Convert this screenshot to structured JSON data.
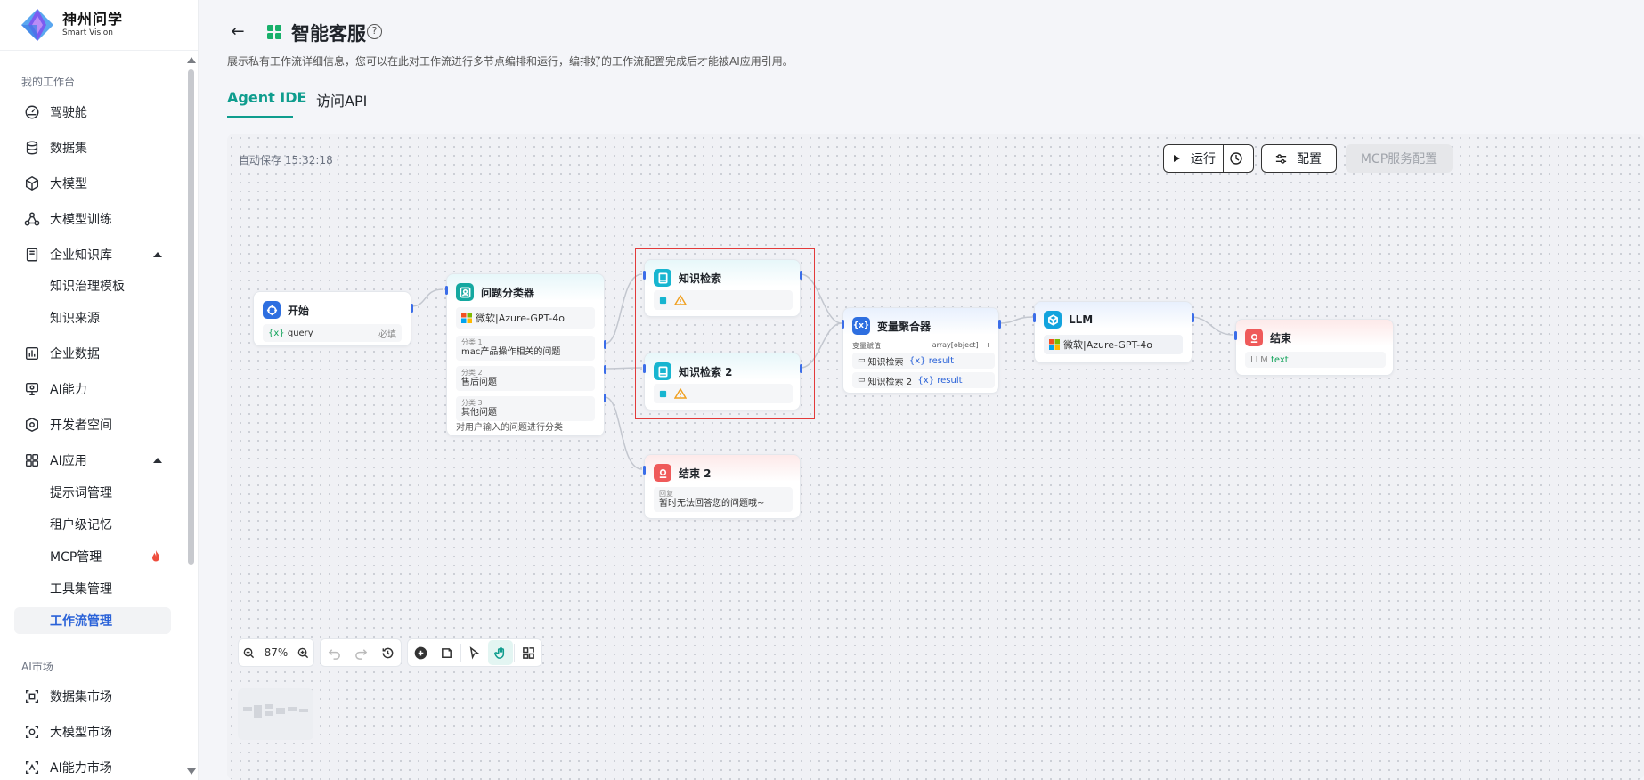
{
  "brand": {
    "name_cn": "神州问学",
    "name_en": "Smart Vision"
  },
  "sidebar": {
    "section1": "我的工作台",
    "items": [
      {
        "label": "驾驶舱",
        "icon": "dashboard-icon"
      },
      {
        "label": "数据集",
        "icon": "database-icon"
      },
      {
        "label": "大模型",
        "icon": "cube-icon"
      },
      {
        "label": "大模型训练",
        "icon": "training-icon"
      },
      {
        "label": "企业知识库",
        "icon": "knowledge-icon"
      },
      {
        "label": "知识治理模板",
        "icon": ""
      },
      {
        "label": "知识来源",
        "icon": ""
      },
      {
        "label": "企业数据",
        "icon": "chart-icon"
      },
      {
        "label": "AI能力",
        "icon": "monitor-icon"
      },
      {
        "label": "开发者空间",
        "icon": "developer-icon"
      },
      {
        "label": "AI应用",
        "icon": "apps-icon"
      },
      {
        "label": "提示词管理",
        "icon": ""
      },
      {
        "label": "租户级记忆",
        "icon": ""
      },
      {
        "label": "MCP管理",
        "icon": "fire-icon"
      },
      {
        "label": "工具集管理",
        "icon": ""
      },
      {
        "label": "工作流管理",
        "icon": ""
      }
    ],
    "section2": "AI市场",
    "market": [
      {
        "label": "数据集市场",
        "icon": "dataset-market-icon"
      },
      {
        "label": "大模型市场",
        "icon": "model-market-icon"
      },
      {
        "label": "AI能力市场",
        "icon": "ai-market-icon"
      }
    ]
  },
  "header": {
    "title": "智能客服",
    "description": "展示私有工作流详细信息，您可以在此对工作流进行多节点编排和运行，编排好的工作流配置完成后才能被AI应用引用。",
    "tabs": [
      "Agent IDE",
      "访问API"
    ]
  },
  "canvas": {
    "autosave": "自动保存 15:32:18 ·",
    "run": "运行",
    "config": "配置",
    "mcp": "MCP服务配置",
    "zoom": "87%"
  },
  "nodes": {
    "start": {
      "title": "开始",
      "var": "query",
      "required": "必填"
    },
    "classifier": {
      "title": "问题分类器",
      "model": "微软|Azure-GPT-4o",
      "classes": [
        {
          "label": "分类 1",
          "text": "mac产品操作相关的问题"
        },
        {
          "label": "分类 2",
          "text": "售后问题"
        },
        {
          "label": "分类 3",
          "text": "其他问题"
        }
      ],
      "footer": "对用户输入的问题进行分类"
    },
    "kr1": {
      "title": "知识检索"
    },
    "kr2": {
      "title": "知识检索 2"
    },
    "end2": {
      "title": "结束 2",
      "reply_label": "回复",
      "reply": "暂时无法回答您的问题哦~"
    },
    "agg": {
      "title": "变量聚合器",
      "label": "变量赋值",
      "type": "array[object]",
      "plus": "+",
      "rows": [
        {
          "src": "知识检索",
          "var": "result"
        },
        {
          "src": "知识检索 2",
          "var": "result"
        }
      ]
    },
    "llm": {
      "title": "LLM",
      "model": "微软|Azure-GPT-4o"
    },
    "end": {
      "title": "结束",
      "src": "LLM",
      "var": "text"
    }
  }
}
